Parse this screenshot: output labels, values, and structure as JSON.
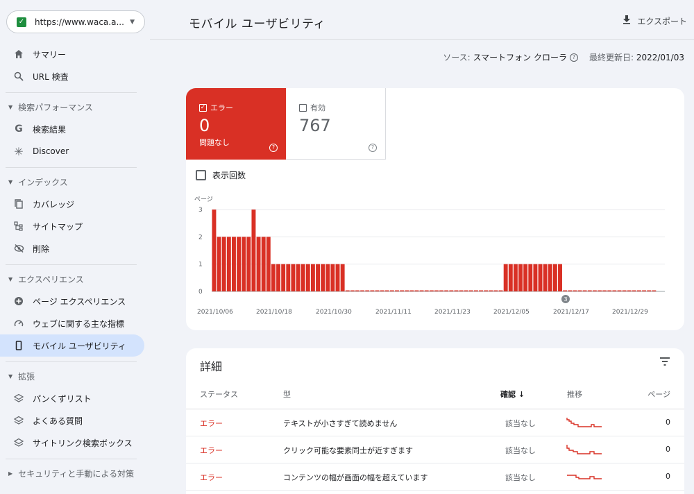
{
  "property": {
    "url": "https://www.waca.a..."
  },
  "sidebar": {
    "summary": "サマリー",
    "url_inspect": "URL 検査",
    "sec_search": "検索パフォーマンス",
    "search_results": "検索結果",
    "discover": "Discover",
    "sec_index": "インデックス",
    "coverage": "カバレッジ",
    "sitemap": "サイトマップ",
    "removals": "削除",
    "sec_experience": "エクスペリエンス",
    "page_experience": "ページ エクスペリエンス",
    "web_vitals": "ウェブに関する主な指標",
    "mobile_usability": "モバイル ユーザビリティ",
    "sec_enhance": "拡張",
    "breadcrumbs": "パンくずリスト",
    "faq": "よくある質問",
    "sitelinks": "サイトリンク検索ボックス",
    "sec_security": "セキュリティと手動による対策"
  },
  "header": {
    "title": "モバイル ユーザビリティ",
    "export": "エクスポート"
  },
  "meta": {
    "source_label": "ソース:",
    "source_value": "スマートフォン クローラ",
    "updated_label": "最終更新日:",
    "updated_value": "2022/01/03"
  },
  "tiles": {
    "error_label": "エラー",
    "error_value": "0",
    "error_sub": "問題なし",
    "valid_label": "有効",
    "valid_value": "767"
  },
  "impressions_label": "表示回数",
  "chart_data": {
    "type": "bar",
    "ylabel": "ページ",
    "ylim": [
      0,
      3
    ],
    "yticks": [
      "0",
      "1",
      "2",
      "3"
    ],
    "xtick_labels": [
      "2021/10/06",
      "2021/10/18",
      "2021/10/30",
      "2021/11/11",
      "2021/11/23",
      "2021/12/05",
      "2021/12/17",
      "2021/12/29"
    ],
    "values": [
      3,
      2,
      2,
      2,
      2,
      2,
      2,
      2,
      3,
      2,
      2,
      2,
      1,
      1,
      1,
      1,
      1,
      1,
      1,
      1,
      1,
      1,
      1,
      1,
      1,
      1,
      1,
      0,
      0,
      0,
      0,
      0,
      0,
      0,
      0,
      0,
      0,
      0,
      0,
      0,
      0,
      0,
      0,
      0,
      0,
      0,
      0,
      0,
      0,
      0,
      0,
      0,
      0,
      0,
      0,
      0,
      0,
      0,
      0,
      1,
      1,
      1,
      1,
      1,
      1,
      1,
      1,
      1,
      1,
      1,
      1,
      0,
      0,
      0,
      0,
      0,
      0,
      0,
      0,
      0,
      0,
      0,
      0,
      0,
      0,
      0,
      0,
      0,
      0,
      0
    ],
    "annotation": "3",
    "color": "#d93025"
  },
  "details": {
    "title": "詳細",
    "columns": {
      "status": "ステータス",
      "type": "型",
      "confirm": "確認",
      "trend": "推移",
      "pages": "ページ"
    },
    "rows": [
      {
        "status": "エラー",
        "type": "テキストが小さすぎて読めません",
        "confirm": "該当なし",
        "pages": "0"
      },
      {
        "status": "エラー",
        "type": "クリック可能な要素同士が近すぎます",
        "confirm": "該当なし",
        "pages": "0"
      },
      {
        "status": "エラー",
        "type": "コンテンツの幅が画面の幅を超えています",
        "confirm": "該当なし",
        "pages": "0"
      }
    ]
  }
}
